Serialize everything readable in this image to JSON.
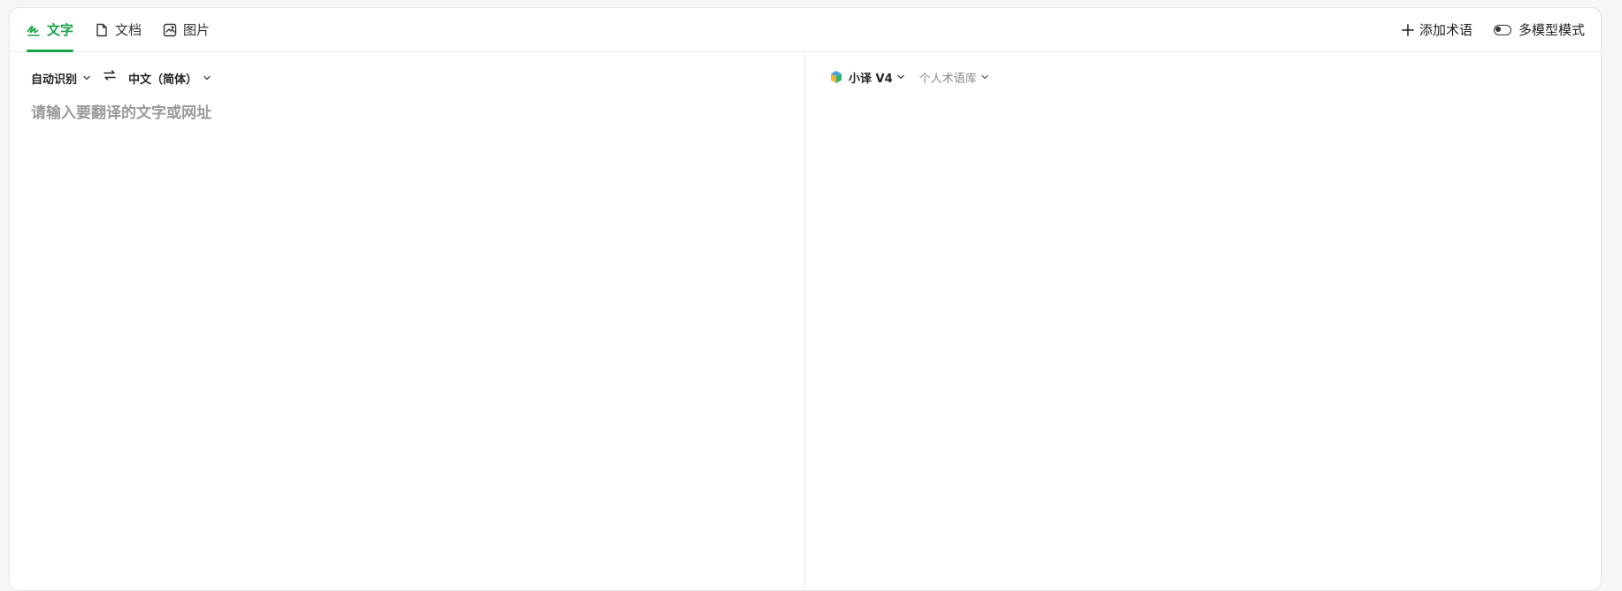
{
  "tabs": [
    {
      "label": "文字",
      "icon": "handwriting-icon",
      "active": true
    },
    {
      "label": "文档",
      "icon": "document-icon",
      "active": false
    },
    {
      "label": "图片",
      "icon": "image-icon",
      "active": false
    }
  ],
  "actions": {
    "add_term_label": "添加术语",
    "multi_model_label": "多模型模式"
  },
  "source": {
    "language": "自动识别",
    "placeholder": "请输入要翻译的文字或网址",
    "value": ""
  },
  "target": {
    "language": "中文（简体）"
  },
  "engine": {
    "name": "小译 V4",
    "term_library": "个人术语库"
  },
  "colors": {
    "accent": "#1aa34a"
  }
}
